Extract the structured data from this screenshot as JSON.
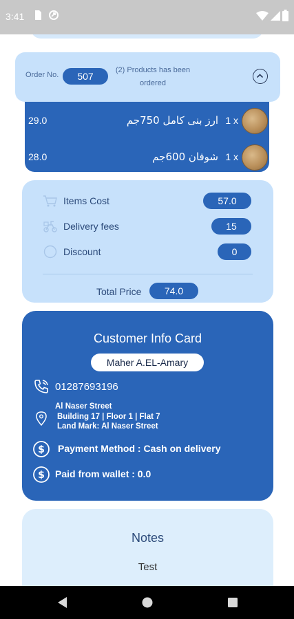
{
  "status_bar": {
    "time": "3:41",
    "icons": [
      "sim-card-icon",
      "data-saver-icon",
      "wifi-icon",
      "cellular-signal-icon",
      "battery-icon"
    ]
  },
  "order": {
    "order_no_label": "Order No.",
    "order_no": "507",
    "products_text_line1": "(2) Products has been",
    "products_text_line2": "ordered",
    "toggle_icon": "chevron-up-icon"
  },
  "products": [
    {
      "price": "29.0",
      "name": "ارز بنى كامل 750جم",
      "qty": "1 x"
    },
    {
      "price": "28.0",
      "name": "شوفان 600جم",
      "qty": "1 x"
    }
  ],
  "costs": {
    "items_cost_label": "Items Cost",
    "items_cost_value": "57.0",
    "delivery_label": "Delivery fees",
    "delivery_value": "15",
    "discount_label": "Discount",
    "discount_value": "0",
    "total_label": "Total Price",
    "total_value": "74.0"
  },
  "customer": {
    "title": "Customer Info Card",
    "name": "Maher A.EL-Amary",
    "phone": "01287693196",
    "address_line1": "Al Naser Street",
    "address_line2": "Building 17 | Floor 1 | Flat 7",
    "address_line3": "Land Mark: Al Naser Street",
    "payment": "Payment Method : Cash on delivery",
    "wallet": "Paid from wallet : 0.0"
  },
  "notes": {
    "title": "Notes",
    "text": "Test"
  },
  "colors": {
    "primary": "#2a65b8",
    "light_card": "#c7e1fb",
    "notes_card": "#ddeefc"
  }
}
